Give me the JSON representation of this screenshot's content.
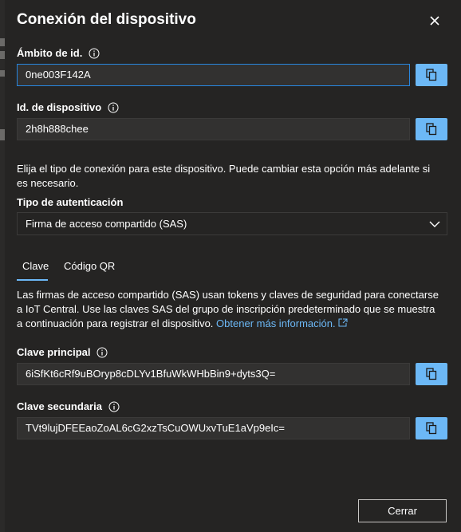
{
  "dialog": {
    "title": "Conexión del dispositivo"
  },
  "id_scope": {
    "label": "Ámbito de id.",
    "value": "0ne003F142A"
  },
  "device_id": {
    "label": "Id. de dispositivo",
    "value": "2h8h888chee"
  },
  "connection_text": "Elija el tipo de conexión para este dispositivo. Puede cambiar esta opción más adelante si es necesario.",
  "auth_type": {
    "label": "Tipo de autenticación",
    "selected": "Firma de acceso compartido (SAS)"
  },
  "tabs": [
    {
      "label": "Clave",
      "selected": true
    },
    {
      "label": "Código QR",
      "selected": false
    }
  ],
  "sas_description": "Las firmas de acceso compartido (SAS) usan tokens y claves de seguridad para conectarse a IoT Central. Use las claves SAS del grupo de inscripción predeterminado que se muestra a continuación para registrar el dispositivo.",
  "learn_more_link": "Obtener más información.",
  "primary_key": {
    "label": "Clave principal",
    "value": "6iSfKt6cRf9uBOryp8cDLYv1BfuWkWHbBin9+dyts3Q="
  },
  "secondary_key": {
    "label": "Clave secundaria",
    "value": "TVt9lujDFEEaoZoAL6cG2xzTsCuOWUxvTuE1aVp9eIc="
  },
  "footer": {
    "cancel_label": "Cerrar"
  },
  "colors": {
    "accent": "#6cb8f6",
    "panel_bg": "#252423",
    "field_bg": "#323130",
    "focus_border": "#2886de"
  }
}
